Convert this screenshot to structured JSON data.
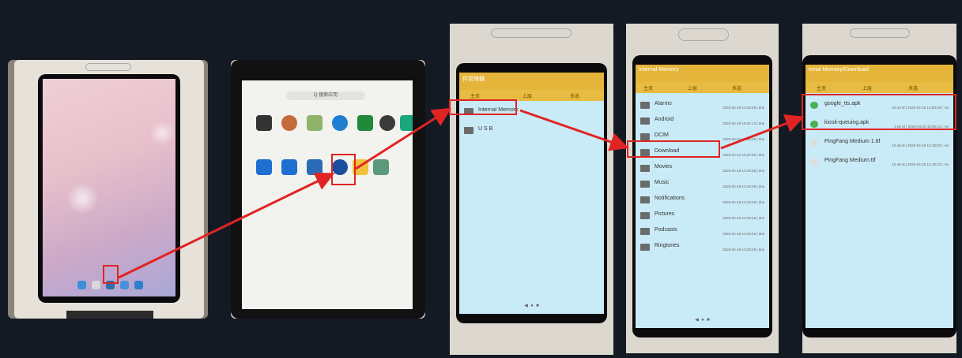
{
  "photo3": {
    "title": "件管理器",
    "toolbar": [
      "主页",
      "上层",
      "多选"
    ],
    "items": [
      "Internal Memory",
      "U S B"
    ]
  },
  "photo4": {
    "title": "Internal Memory",
    "toolbar": [
      "主页",
      "上层",
      "多选"
    ],
    "folders": [
      {
        "name": "Alarms",
        "meta": "2023-04-19 13:40:28 | drw"
      },
      {
        "name": "Android",
        "meta": "2023-04-19 16:01:13 | drw"
      },
      {
        "name": "DCIM",
        "meta": "2023-04-21 13:39:30 | drw"
      },
      {
        "name": "Download",
        "meta": "2023-04-21 13:37:00 | drw"
      },
      {
        "name": "Movies",
        "meta": "2023-04-19 13:40:28 | drw"
      },
      {
        "name": "Music",
        "meta": "2023-04-19 13:40:28 | drw"
      },
      {
        "name": "Notifications",
        "meta": "2023-04-19 13:40:28 | drw"
      },
      {
        "name": "Pictures",
        "meta": "2023-04-19 13:40:28 | drw"
      },
      {
        "name": "Podcasts",
        "meta": "2023-04-19 13:40:28 | drw"
      },
      {
        "name": "Ringtones",
        "meta": "2023-04-19 13:40:28 | drw"
      }
    ]
  },
  "photo5": {
    "title": "ernal Memory/Download",
    "toolbar": [
      "主页",
      "上层",
      "多选"
    ],
    "files": [
      {
        "name": "google_tts.apk",
        "meta": "20.43 M | 2023-04-20 13:50:35 | -rw"
      },
      {
        "name": "kiosk-queuing.apk",
        "meta": "1.82 M | 2023-04-20 13:50:11 | -rw"
      },
      {
        "name": "PingFang Medium 1.ttf",
        "meta": "10.46 M | 2023-04-20 10:18:50 | -rw"
      },
      {
        "name": "PingFang Medium.ttf",
        "meta": "10.46 M | 2023-04-20 10:18:23 | -rw"
      }
    ]
  },
  "photo2": {
    "search_placeholder": "Q 搜索应用"
  },
  "colors": {
    "background": "#141a24",
    "annotation": "#e02424",
    "appbar": "#e4b53a",
    "screen": "#c9ebf7"
  }
}
